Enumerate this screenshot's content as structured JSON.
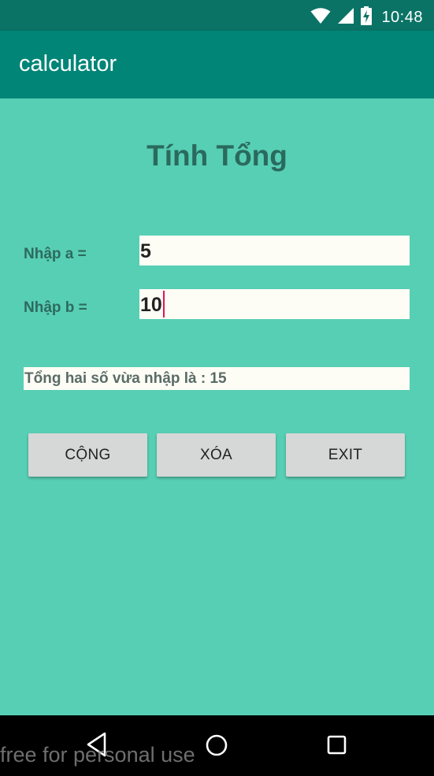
{
  "status_bar": {
    "time": "10:48",
    "icons": [
      "wifi-icon",
      "cellular-signal-icon",
      "battery-charging-icon"
    ]
  },
  "app_bar": {
    "title": "calculator"
  },
  "main": {
    "title": "Tính Tổng",
    "label_a": "Nhập a =",
    "value_a": "5",
    "label_b": "Nhập b =",
    "value_b": "10",
    "result_text": "Tổng hai số vừa nhập là : 15",
    "buttons": {
      "add": "CỘNG",
      "clear": "XÓA",
      "exit": "EXIT"
    }
  },
  "nav_bar": {
    "icons": [
      "back-icon",
      "home-icon",
      "recents-icon"
    ]
  },
  "watermark": "free for personal use",
  "colors": {
    "status_bar": "#0a7365",
    "app_bar": "#008577",
    "background": "#57cfb4",
    "title_text": "#2a6a5d",
    "input_bg": "#fdfdf5",
    "cursor": "#e0135b",
    "button_bg": "#d6d7d7"
  }
}
